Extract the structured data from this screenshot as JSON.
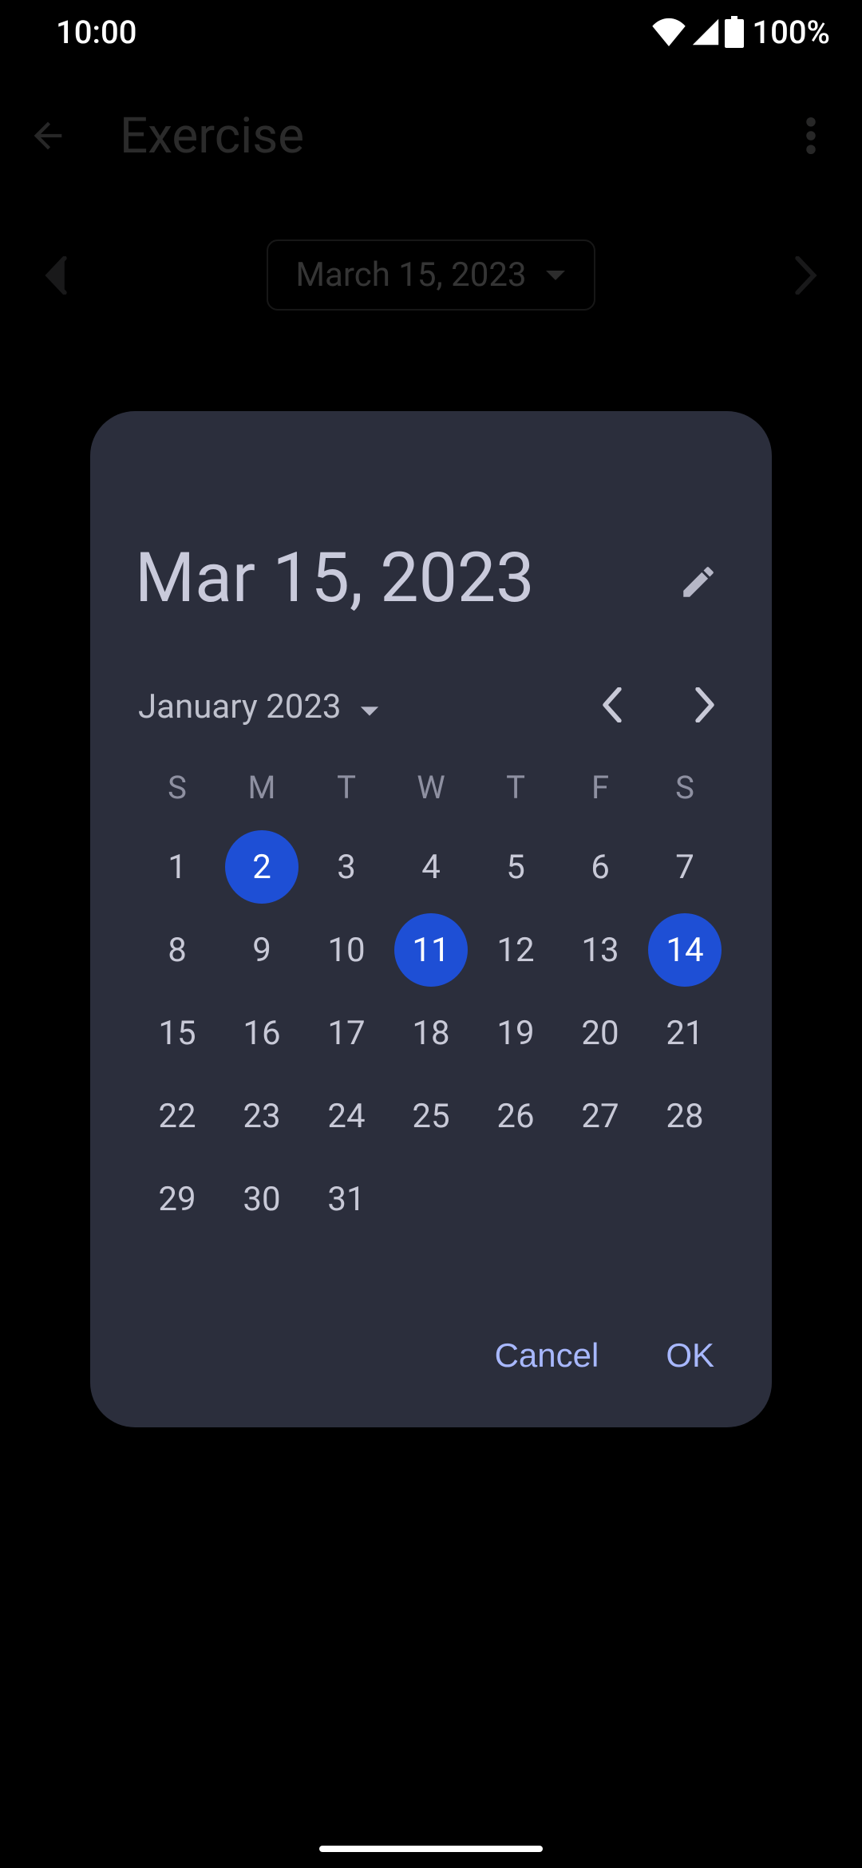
{
  "status": {
    "time": "10:00",
    "battery": "100%"
  },
  "page": {
    "title": "Exercise",
    "date_label": "March 15, 2023"
  },
  "picker": {
    "headline": "Mar 15, 2023",
    "month_label": "January 2023",
    "dow": [
      "S",
      "M",
      "T",
      "W",
      "T",
      "F",
      "S"
    ],
    "days": [
      1,
      2,
      3,
      4,
      5,
      6,
      7,
      8,
      9,
      10,
      11,
      12,
      13,
      14,
      15,
      16,
      17,
      18,
      19,
      20,
      21,
      22,
      23,
      24,
      25,
      26,
      27,
      28,
      29,
      30,
      31
    ],
    "marked": [
      2,
      11,
      14
    ],
    "actions": {
      "cancel": "Cancel",
      "ok": "OK"
    }
  }
}
